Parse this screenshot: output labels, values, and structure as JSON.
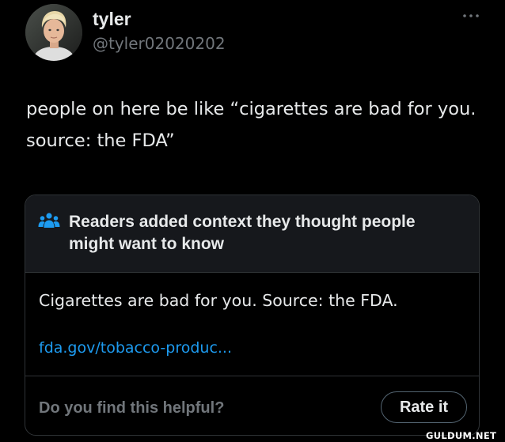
{
  "author": {
    "display_name": "tyler",
    "handle": "@tyler02020202",
    "avatar_icon": "user-avatar-photo"
  },
  "more_icon": "more-options-icon",
  "tweet": {
    "text": "people on here be like “cigarettes are bad for you. source: the FDA”"
  },
  "community_note": {
    "icon": "people-group-icon",
    "title": "Readers added context they thought people might want to know",
    "body": "Cigarettes are bad for you. Source: the FDA.",
    "link_text": "fda.gov/tobacco-produc...",
    "helpful_question": "Do you find this helpful?",
    "rate_button": "Rate it"
  },
  "watermark": "GULDUM.NET",
  "colors": {
    "background": "#000000",
    "primary_text": "#e7e9ea",
    "secondary_text": "#71767b",
    "link": "#1d9bf0",
    "note_icon": "#1d9bf0",
    "card_header": "#16181c",
    "border": "#2f3336"
  }
}
